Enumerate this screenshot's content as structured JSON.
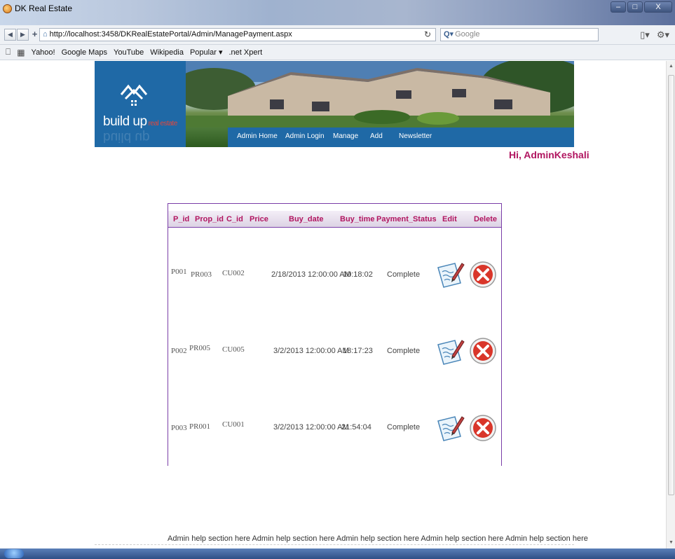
{
  "window": {
    "title": "DK Real Estate"
  },
  "browser": {
    "url": "http://localhost:3458/DKRealEstatePortal/Admin/ManagePayment.aspx",
    "search_placeholder": "Google",
    "bookmarks": [
      "Yahoo!",
      "Google Maps",
      "YouTube",
      "Wikipedia",
      "Popular ▾",
      ".net Xpert"
    ]
  },
  "site": {
    "logo_main": "build up",
    "logo_sub": "real estate",
    "menu": [
      "Admin Home",
      "Admin Login",
      "Manage",
      "Add",
      "Newsletter"
    ],
    "greeting": "Hi, AdminKeshali"
  },
  "grid": {
    "columns": [
      "P_id",
      "Prop_id",
      "C_id",
      "Price",
      "Buy_date",
      "Buy_time",
      "Payment_Status",
      "Edit",
      "Delete"
    ],
    "rows": [
      {
        "p_id": "P001",
        "prop_id": "PR003",
        "c_id": "CU002",
        "price": "",
        "buy_date": "2/18/2013 12:00:00 AM",
        "buy_time": "10:18:02",
        "status": "Complete"
      },
      {
        "p_id": "P002",
        "prop_id": "PR005",
        "c_id": "CU005",
        "price": "",
        "buy_date": "3/2/2013 12:00:00 AM",
        "buy_time": "18:17:23",
        "status": "Complete"
      },
      {
        "p_id": "P003",
        "prop_id": "PR001",
        "c_id": "CU001",
        "price": "",
        "buy_date": "3/2/2013 12:00:00 AM",
        "buy_time": "21:54:04",
        "status": "Complete"
      }
    ]
  },
  "footer": {
    "help_text": "Admin help section here Admin help section here Admin help section here Admin help section here Admin help section here"
  },
  "colors": {
    "brand_blue": "#1f69a6",
    "accent_magenta": "#b11560",
    "grid_border": "#7a3ea8"
  },
  "icons": [
    "back-icon",
    "forward-icon",
    "add-icon",
    "home-icon",
    "reload-icon",
    "search-icon",
    "page-icon",
    "settings-icon",
    "bookmarks-icon",
    "apps-icon",
    "edit-icon",
    "delete-icon"
  ]
}
